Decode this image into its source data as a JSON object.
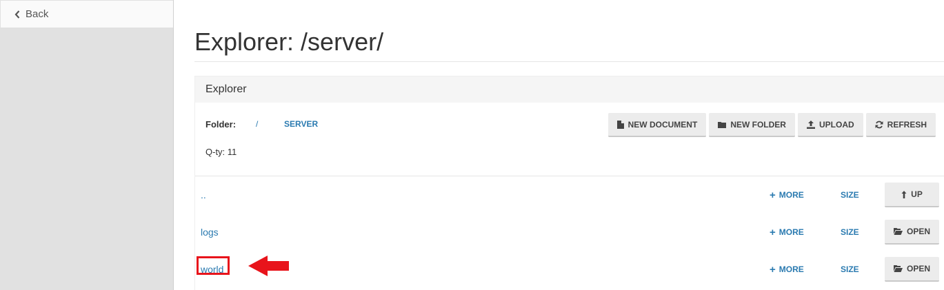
{
  "sidebar": {
    "back_label": "Back"
  },
  "page": {
    "title": "Explorer: /server/"
  },
  "panel": {
    "heading": "Explorer",
    "folder_label": "Folder:",
    "breadcrumbs": [
      "/",
      "SERVER"
    ],
    "qty_text": "Q-ty: 11"
  },
  "toolbar": {
    "new_document": "NEW DOCUMENT",
    "new_folder": "NEW FOLDER",
    "upload": "UPLOAD",
    "refresh": "REFRESH"
  },
  "rows": [
    {
      "name": "..",
      "more": "MORE",
      "size": "SIZE",
      "action": "UP"
    },
    {
      "name": "logs",
      "more": "MORE",
      "size": "SIZE",
      "action": "OPEN"
    },
    {
      "name": "world",
      "more": "MORE",
      "size": "SIZE",
      "action": "OPEN"
    }
  ],
  "colors": {
    "link": "#2a7ab0",
    "annotation": "#e8141b",
    "sidebar_bg": "#e1e1e1"
  }
}
